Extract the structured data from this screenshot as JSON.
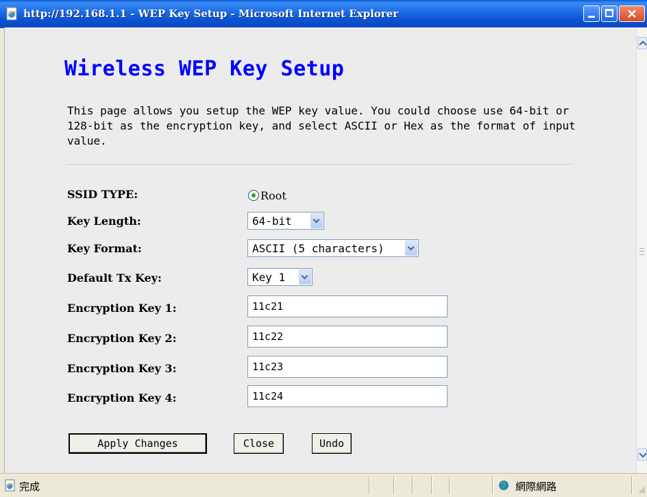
{
  "window": {
    "title": "http://192.168.1.1 - WEP Key Setup - Microsoft Internet Explorer"
  },
  "page": {
    "heading": "Wireless WEP Key Setup",
    "description": "This page allows you setup the WEP key value. You could choose use 64-bit or 128-bit as the encryption key, and select ASCII or Hex as the format of input value."
  },
  "form": {
    "ssid_type": {
      "label": "SSID TYPE:",
      "option": "Root",
      "selected": true
    },
    "key_length": {
      "label": "Key Length:",
      "value": "64-bit"
    },
    "key_format": {
      "label": "Key Format:",
      "value": "ASCII (5 characters)"
    },
    "default_tx_key": {
      "label": "Default Tx Key:",
      "value": "Key 1"
    },
    "keys": [
      {
        "label": "Encryption Key 1:",
        "value": "11c21"
      },
      {
        "label": "Encryption Key 2:",
        "value": "11c22"
      },
      {
        "label": "Encryption Key 3:",
        "value": "11c23"
      },
      {
        "label": "Encryption Key 4:",
        "value": "11c24"
      }
    ]
  },
  "buttons": {
    "apply": "Apply Changes",
    "close": "Close",
    "undo": "Undo"
  },
  "statusbar": {
    "status": "完成",
    "zone": "網際網路"
  },
  "colors": {
    "heading": "#0000ff",
    "titlebar": "#0a5bd6",
    "content_bg": "#ececec"
  },
  "icons": [
    "ie-page-icon",
    "minimize-icon",
    "maximize-icon",
    "close-icon",
    "scroll-up-icon",
    "scroll-down-icon",
    "done-page-icon",
    "internet-globe-icon",
    "resize-grip-icon"
  ]
}
